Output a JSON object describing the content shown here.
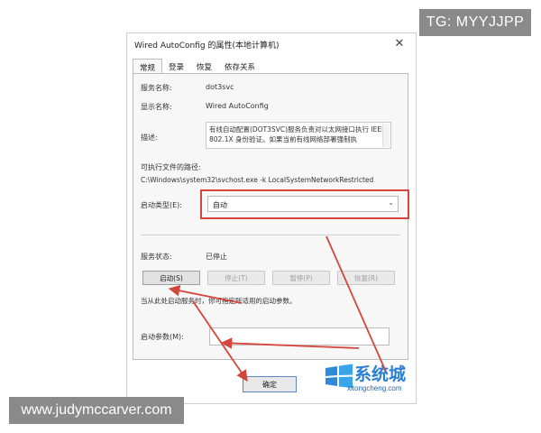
{
  "badge": {
    "text": "TG: MYYJJPP"
  },
  "dialog": {
    "title": "Wired AutoConfig 的属性(本地计算机)",
    "close_symbol": "✕",
    "tabs": [
      "常规",
      "登录",
      "恢复",
      "依存关系"
    ],
    "active_tab": "常规",
    "service_name_label": "服务名称:",
    "service_name": "dot3svc",
    "display_name_label": "显示名称:",
    "display_name": "Wired AutoConfig",
    "description_label": "描述:",
    "description": "有线自动配置(DOT3SVC)服务负责对以太网接口执行 IEEE 802.1X 身份验证。如果当前有线网络部署强制执",
    "exe_path_label": "可执行文件的路径:",
    "exe_path": "C:\\Windows\\system32\\svchost.exe -k LocalSystemNetworkRestricted",
    "startup_type_label": "启动类型(E):",
    "startup_type_value": "自动",
    "status_label": "服务状态:",
    "status_value": "已停止",
    "buttons": {
      "start": "启动(S)",
      "stop": "停止(T)",
      "pause": "暂停(P)",
      "resume": "恢复(R)"
    },
    "hint": "当从此处启动服务时，你可指定所适用的启动参数。",
    "start_params_label": "启动参数(M):",
    "start_params_value": "",
    "ok_button": "确定"
  },
  "logo": {
    "brand": "系统城",
    "url": "xitongcheng.com"
  },
  "watermark": {
    "text": "www.judymccarver.com"
  },
  "colors": {
    "annotation": "#d4453c",
    "ok_border": "#5a86c8",
    "logo_blue": "#2c7fd0"
  }
}
